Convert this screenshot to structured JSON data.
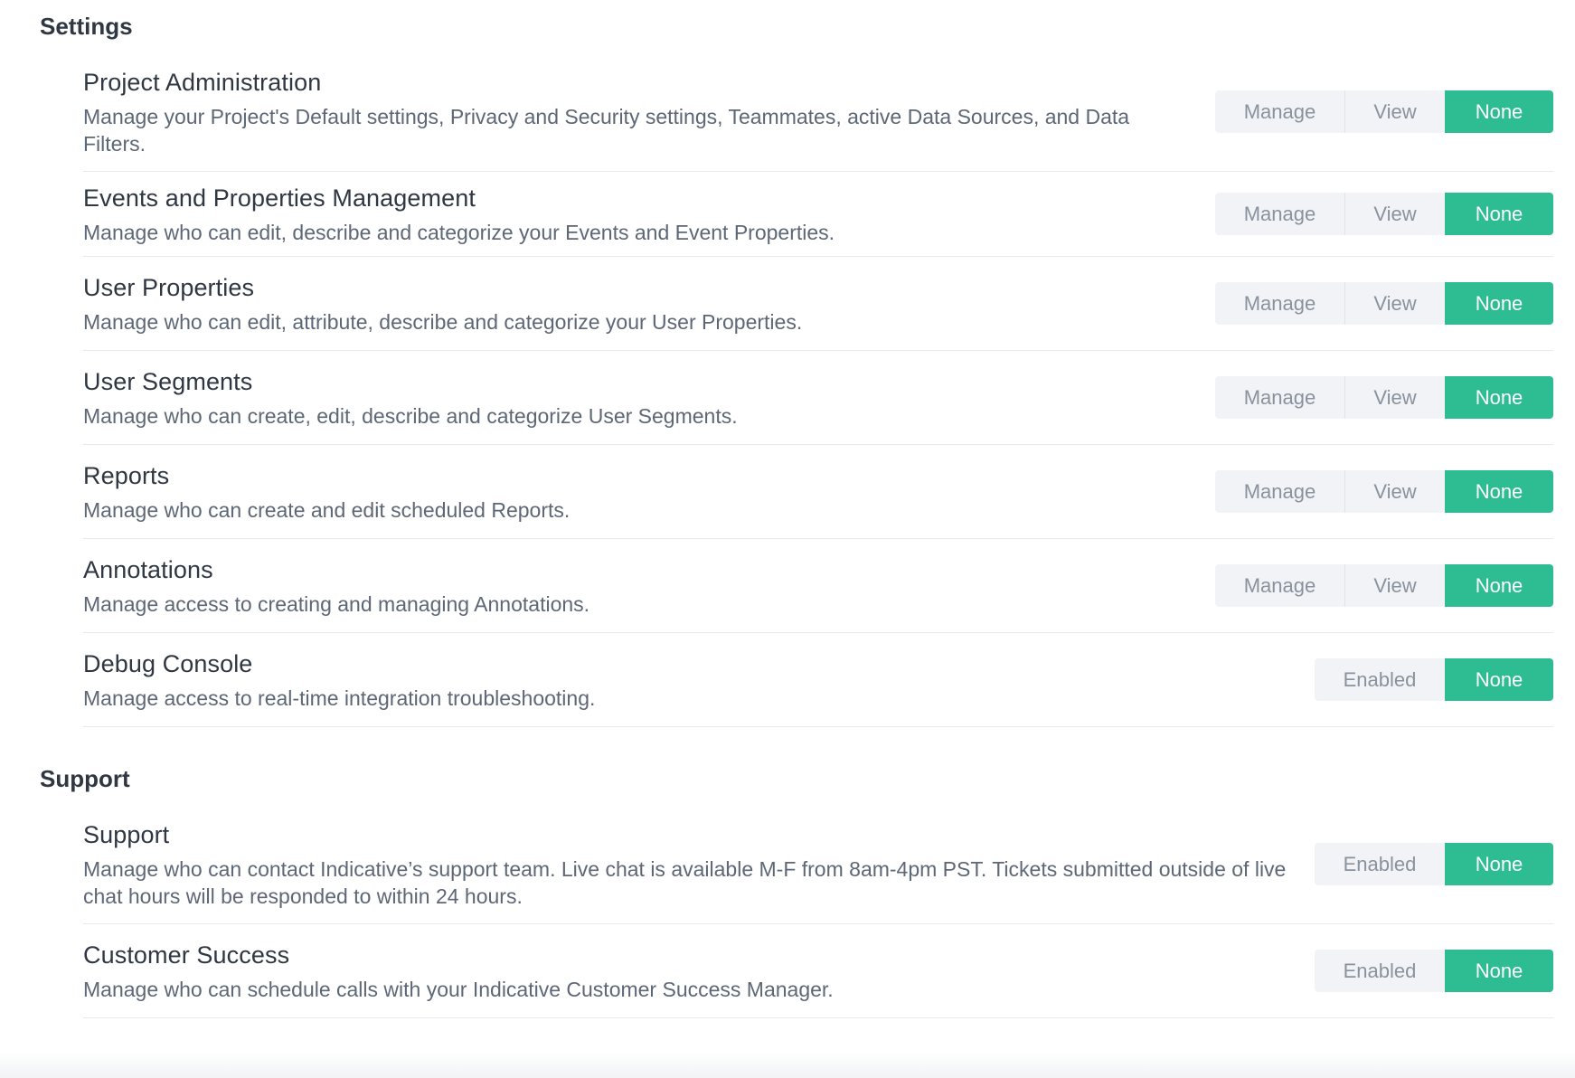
{
  "sections": [
    {
      "title": "Settings",
      "rows": [
        {
          "title": "Project Administration",
          "description": "Manage your Project's Default settings, Privacy and Security settings, Teammates, active Data Sources, and Data Filters.",
          "options": [
            "Manage",
            "View",
            "None"
          ],
          "selected": "None"
        },
        {
          "title": "Events and Properties Management",
          "description": "Manage who can edit, describe and categorize your Events and Event Properties.",
          "options": [
            "Manage",
            "View",
            "None"
          ],
          "selected": "None"
        },
        {
          "title": "User Properties",
          "description": "Manage who can edit, attribute, describe and categorize your User Properties.",
          "options": [
            "Manage",
            "View",
            "None"
          ],
          "selected": "None"
        },
        {
          "title": "User Segments",
          "description": "Manage who can create, edit, describe and categorize User Segments.",
          "options": [
            "Manage",
            "View",
            "None"
          ],
          "selected": "None"
        },
        {
          "title": "Reports",
          "description": "Manage who can create and edit scheduled Reports.",
          "options": [
            "Manage",
            "View",
            "None"
          ],
          "selected": "None"
        },
        {
          "title": "Annotations",
          "description": "Manage access to creating and managing Annotations.",
          "options": [
            "Manage",
            "View",
            "None"
          ],
          "selected": "None"
        },
        {
          "title": "Debug Console",
          "description": "Manage access to real-time integration troubleshooting.",
          "options": [
            "Enabled",
            "None"
          ],
          "selected": "None"
        }
      ]
    },
    {
      "title": "Support",
      "rows": [
        {
          "title": "Support",
          "description": "Manage who can contact Indicative’s support team. Live chat is available M-F from 8am-4pm PST. Tickets submitted outside of live chat hours will be responded to within 24 hours.",
          "options": [
            "Enabled",
            "None"
          ],
          "selected": "None"
        },
        {
          "title": "Customer Success",
          "description": "Manage who can schedule calls with your Indicative Customer Success Manager.",
          "options": [
            "Enabled",
            "None"
          ],
          "selected": "None"
        }
      ]
    }
  ],
  "colors": {
    "active": "#2ebd93",
    "inactive_bg": "#f1f3f6",
    "inactive_text": "#8a929e"
  }
}
